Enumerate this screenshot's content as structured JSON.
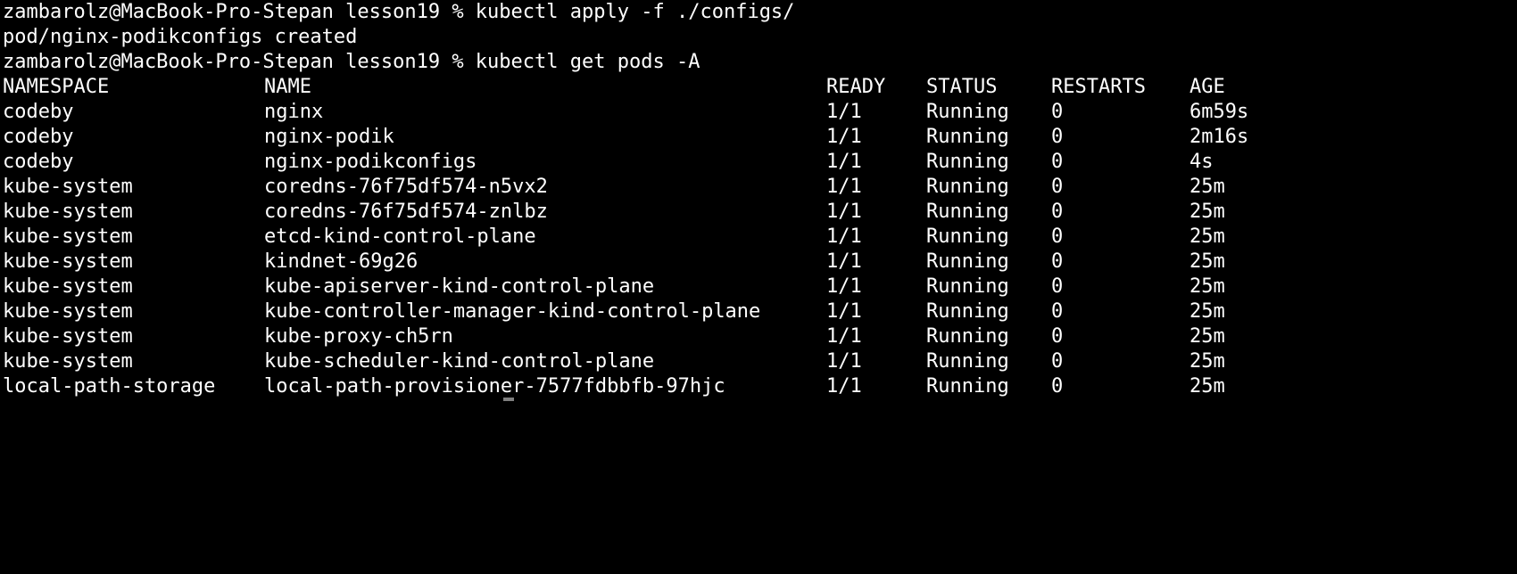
{
  "terminal": {
    "lines": [
      "zambarolz@MacBook-Pro-Stepan lesson19 % kubectl apply -f ./configs/",
      "pod/nginx-podikconfigs created",
      "zambarolz@MacBook-Pro-Stepan lesson19 % kubectl get pods -A"
    ],
    "table": {
      "headers": {
        "namespace": "NAMESPACE",
        "name": "NAME",
        "ready": "READY",
        "status": "STATUS",
        "restarts": "RESTARTS",
        "age": "AGE"
      },
      "rows": [
        {
          "namespace": "codeby",
          "name": "nginx",
          "ready": "1/1",
          "status": "Running",
          "restarts": "0",
          "age": "6m59s"
        },
        {
          "namespace": "codeby",
          "name": "nginx-podik",
          "ready": "1/1",
          "status": "Running",
          "restarts": "0",
          "age": "2m16s"
        },
        {
          "namespace": "codeby",
          "name": "nginx-podikconfigs",
          "ready": "1/1",
          "status": "Running",
          "restarts": "0",
          "age": "4s"
        },
        {
          "namespace": "kube-system",
          "name": "coredns-76f75df574-n5vx2",
          "ready": "1/1",
          "status": "Running",
          "restarts": "0",
          "age": "25m"
        },
        {
          "namespace": "kube-system",
          "name": "coredns-76f75df574-znlbz",
          "ready": "1/1",
          "status": "Running",
          "restarts": "0",
          "age": "25m"
        },
        {
          "namespace": "kube-system",
          "name": "etcd-kind-control-plane",
          "ready": "1/1",
          "status": "Running",
          "restarts": "0",
          "age": "25m"
        },
        {
          "namespace": "kube-system",
          "name": "kindnet-69g26",
          "ready": "1/1",
          "status": "Running",
          "restarts": "0",
          "age": "25m"
        },
        {
          "namespace": "kube-system",
          "name": "kube-apiserver-kind-control-plane",
          "ready": "1/1",
          "status": "Running",
          "restarts": "0",
          "age": "25m"
        },
        {
          "namespace": "kube-system",
          "name": "kube-controller-manager-kind-control-plane",
          "ready": "1/1",
          "status": "Running",
          "restarts": "0",
          "age": "25m"
        },
        {
          "namespace": "kube-system",
          "name": "kube-proxy-ch5rn",
          "ready": "1/1",
          "status": "Running",
          "restarts": "0",
          "age": "25m"
        },
        {
          "namespace": "kube-system",
          "name": "kube-scheduler-kind-control-plane",
          "ready": "1/1",
          "status": "Running",
          "restarts": "0",
          "age": "25m"
        },
        {
          "namespace": "local-path-storage",
          "name": "local-path-provisioner-7577fdbbfb-97hjc",
          "ready": "1/1",
          "status": "Running",
          "restarts": "0",
          "age": "25m"
        }
      ]
    }
  },
  "colors": {
    "background": "#000000",
    "foreground": "#ffffff",
    "cursor": "#7f7f7f"
  }
}
